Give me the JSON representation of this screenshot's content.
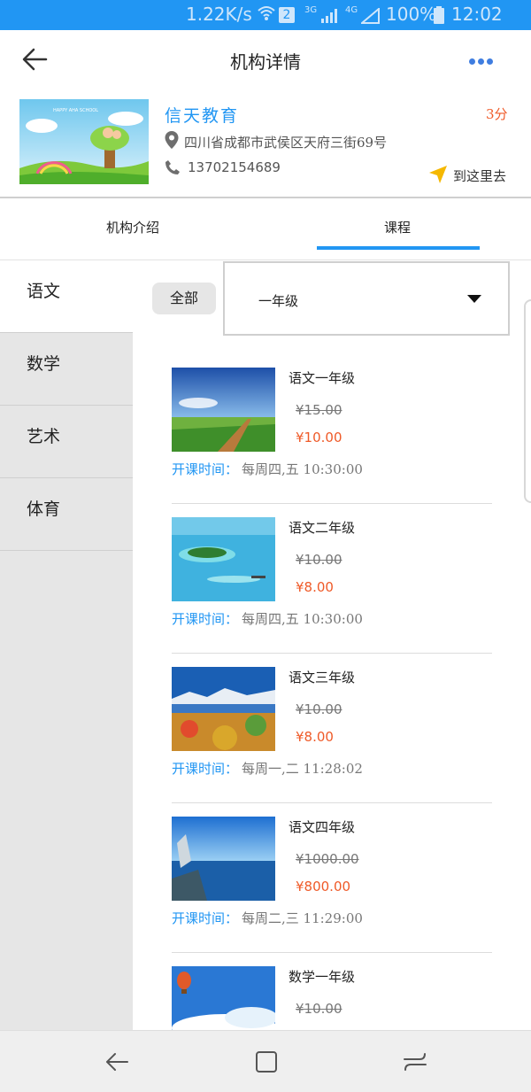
{
  "status_bar": {
    "speed": "1.22K/s",
    "badge": "2",
    "net_3g": "3G",
    "net_4g": "4G",
    "battery": "100%",
    "time": "12:02"
  },
  "header": {
    "title": "机构详情"
  },
  "org": {
    "name": "信天教育",
    "score": "3分",
    "address": "四川省成都市武侯区天府三街69号",
    "phone": "13702154689",
    "nav_label": "到这里去",
    "image_caption": "HAPPY AHA SCHOOL"
  },
  "tabs": [
    {
      "label": "机构介绍",
      "active": false
    },
    {
      "label": "课程",
      "active": true
    }
  ],
  "subjects": [
    {
      "label": "语文",
      "active": true
    },
    {
      "label": "数学",
      "active": false
    },
    {
      "label": "艺术",
      "active": false
    },
    {
      "label": "体育",
      "active": false
    }
  ],
  "filter": {
    "all_label": "全部",
    "grade_value": "一年级"
  },
  "courses": [
    {
      "name": "语文一年级",
      "old_price": "¥15.00",
      "price": "¥10.00",
      "time_label": "开课时间：",
      "time": "每周四,五    10:30:00",
      "thumb": "prairie-road"
    },
    {
      "name": "语文二年级",
      "old_price": "¥10.00",
      "price": "¥8.00",
      "time_label": "开课时间：",
      "time": "每周四,五    10:30:00",
      "thumb": "tropical-island"
    },
    {
      "name": "语文三年级",
      "old_price": "¥10.00",
      "price": "¥8.00",
      "time_label": "开课时间：",
      "time": "每周一,二    11:28:02",
      "thumb": "mountain-flowers"
    },
    {
      "name": "语文四年级",
      "old_price": "¥1000.00",
      "price": "¥800.00",
      "time_label": "开课时间：",
      "time": "每周二,三    11:29:00",
      "thumb": "ocean-rock"
    },
    {
      "name": "数学一年级",
      "old_price": "¥10.00",
      "price": "",
      "time_label": "",
      "time": "",
      "thumb": "balloon-sky"
    }
  ],
  "colors": {
    "accent": "#2196f3",
    "price": "#ef5a28",
    "sidebar": "#e6e6e6"
  }
}
